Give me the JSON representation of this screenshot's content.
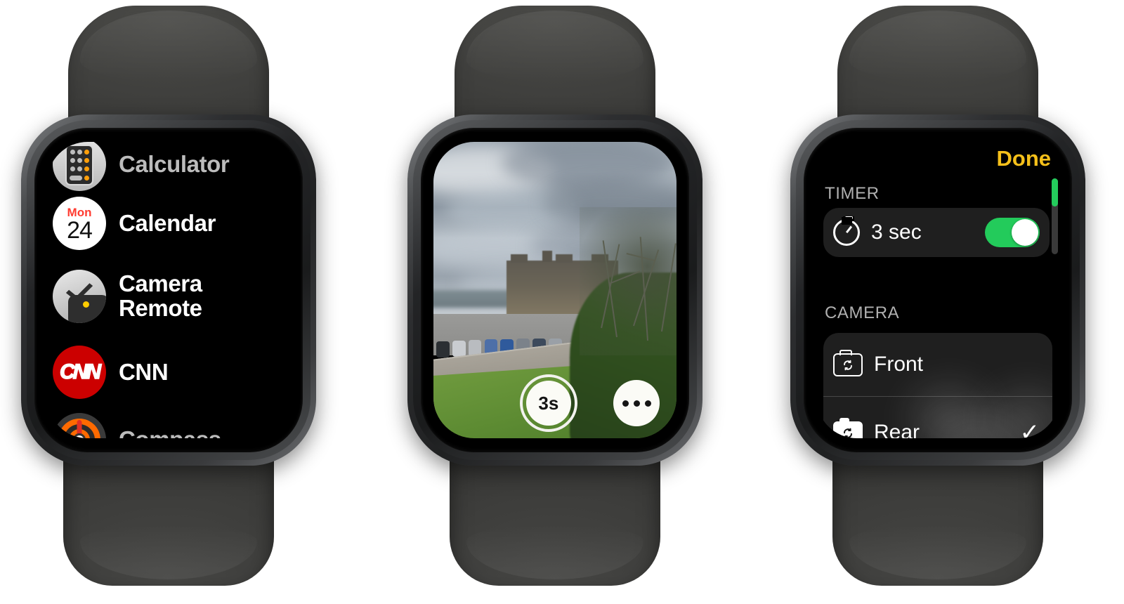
{
  "watches": [
    {
      "name": "app-list",
      "screen": "app_list",
      "apps": [
        {
          "label": "Calculator",
          "icon": "calculator-icon",
          "dim": true
        },
        {
          "label": "Calendar",
          "icon": "calendar-icon",
          "dim": false,
          "day_of_week": "Mon",
          "day_number": "24"
        },
        {
          "label": "Camera Remote",
          "icon": "camera-remote-icon",
          "dim": false
        },
        {
          "label": "CNN",
          "icon": "cnn-icon",
          "dim": false,
          "wordmark": "CNN"
        },
        {
          "label": "Compass",
          "icon": "compass-icon",
          "dim": true
        }
      ]
    },
    {
      "name": "camera-viewfinder",
      "screen": "viewfinder",
      "shutter_label": "3s",
      "shutter_icon": "shutter-button-icon",
      "more_icon": "ellipsis-icon",
      "photo_subject": "castle on a hill under overcast sky with parking lot and grass bank"
    },
    {
      "name": "camera-settings",
      "screen": "settings",
      "done_label": "Done",
      "done_color": "#f5c01a",
      "sections": [
        {
          "header": "TIMER",
          "rows": [
            {
              "label": "3 sec",
              "icon": "timer-icon",
              "control": "toggle",
              "toggle_on": true,
              "toggle_color": "#23cb5b"
            }
          ]
        },
        {
          "header": "CAMERA",
          "rows": [
            {
              "label": "Front",
              "icon": "camera-flip-outline-icon",
              "control": "none",
              "selected": false
            },
            {
              "label": "Rear",
              "icon": "camera-flip-filled-icon",
              "control": "checkmark",
              "selected": true,
              "check_glyph": "✓"
            }
          ]
        }
      ],
      "scroll_indicator_color": "#24cc5c"
    }
  ]
}
